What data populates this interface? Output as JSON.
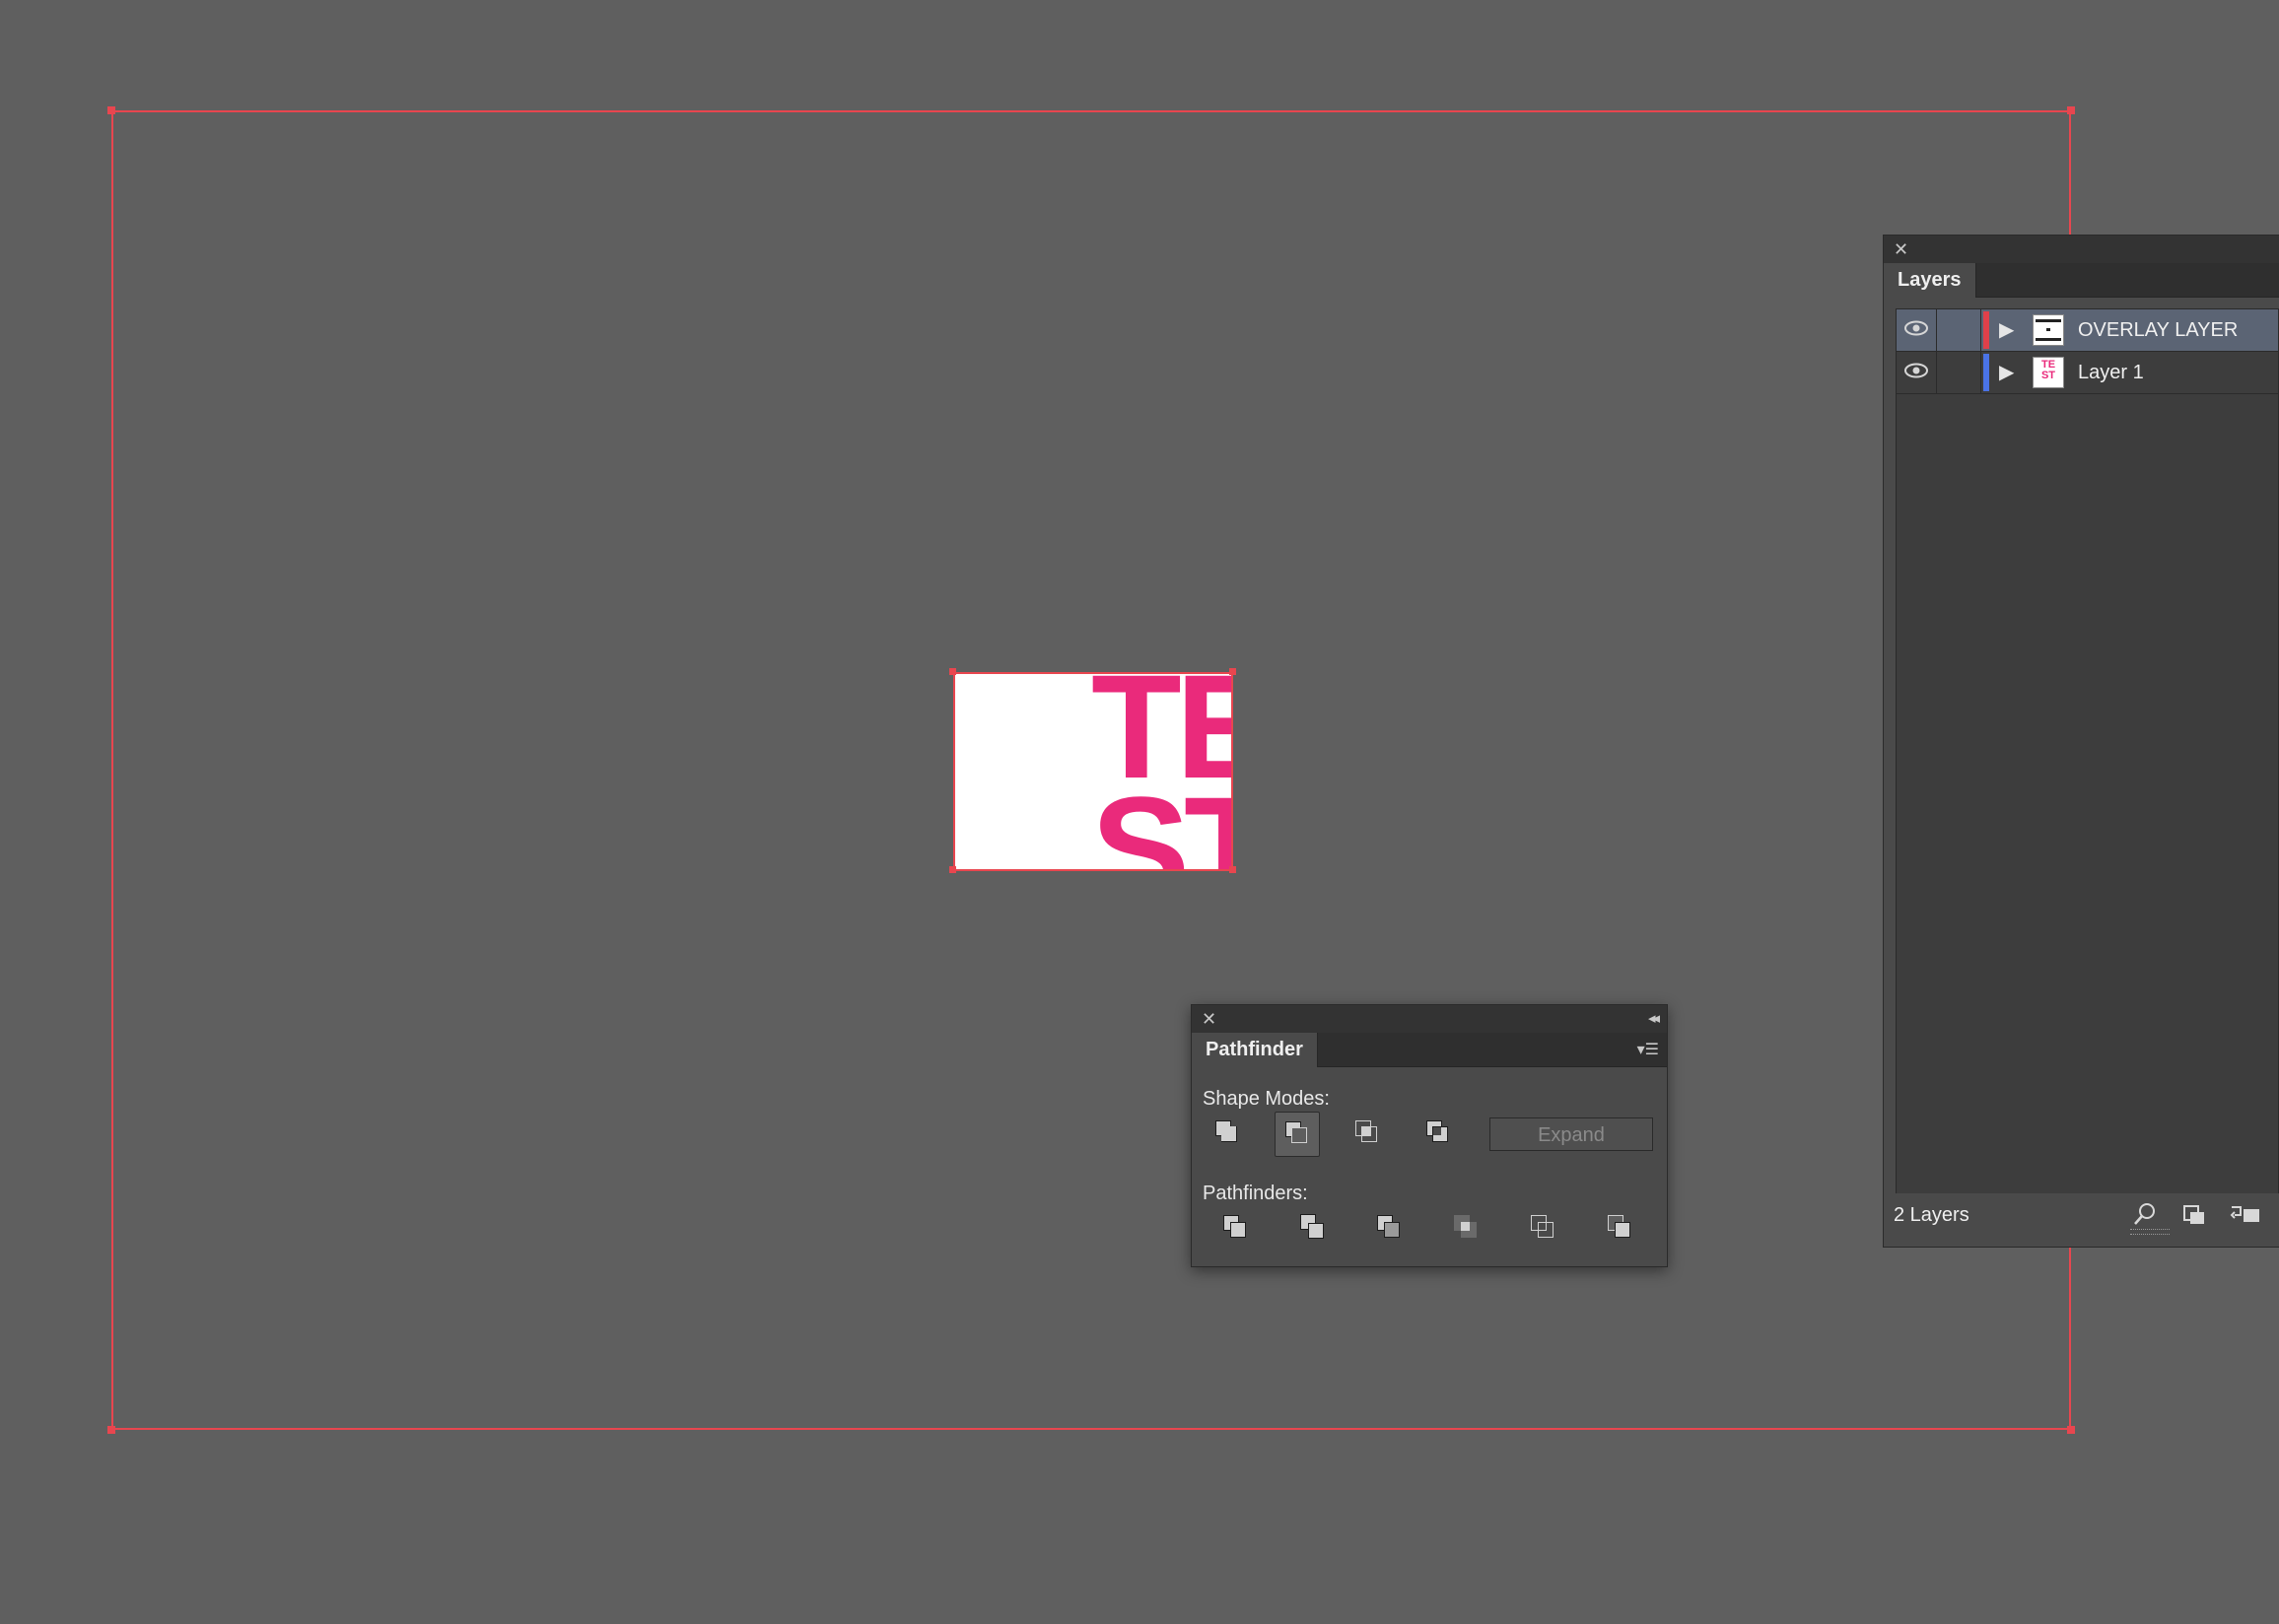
{
  "layers_panel": {
    "tab_label": "Layers",
    "layers": [
      {
        "name": "OVERLAY LAYER",
        "color": "#e0404a",
        "selected": true
      },
      {
        "name": "Layer 1",
        "color": "#4a73e6",
        "selected": false
      }
    ],
    "footer_count": "2 Layers"
  },
  "artwork": {
    "thumb_text": "TE ST",
    "letter_1": "TE",
    "letter_2": "ST",
    "text_color": "#ea2a7b"
  },
  "pathfinder_panel": {
    "tab_label": "Pathfinder",
    "shape_modes_label": "Shape Modes:",
    "pathfinders_label": "Pathfinders:",
    "expand_label": "Expand",
    "shape_mode_buttons": [
      "unite-icon",
      "minus-front-icon",
      "intersect-icon",
      "exclude-icon"
    ],
    "pathfinder_buttons": [
      "divide-icon",
      "trim-icon",
      "merge-icon",
      "crop-icon",
      "outline-icon",
      "minus-back-icon"
    ]
  },
  "selection_color": "#e8464f"
}
